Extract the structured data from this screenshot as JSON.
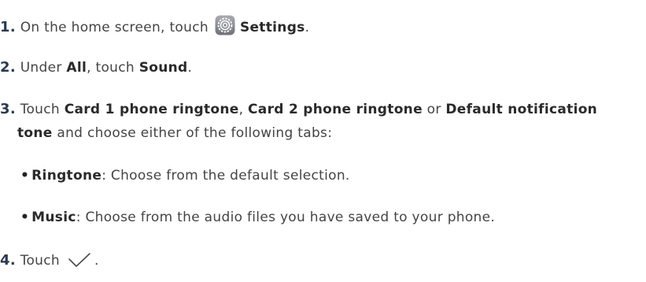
{
  "steps": [
    {
      "number": "1.",
      "pre": "On the home screen, touch",
      "icon": "settings-gear-icon",
      "bold": "Settings",
      "post": "."
    },
    {
      "number": "2.",
      "pre": "Under",
      "bold1": "All",
      "mid": ", touch",
      "bold2": "Sound",
      "post": "."
    },
    {
      "number": "3.",
      "pre": "Touch",
      "bold1": "Card 1 phone ringtone",
      "sep1": ",",
      "bold2": "Card 2 phone ringtone",
      "sep2": "or",
      "bold3": "Default notification",
      "cont_bold": "tone",
      "cont_text": "and choose either of the following tabs:",
      "sub_items": [
        {
          "bullet": "•",
          "label": "Ringtone",
          "text": ": Choose from the default selection."
        },
        {
          "bullet": "•",
          "label": "Music",
          "text": ": Choose from the audio files you have saved to your phone."
        }
      ]
    },
    {
      "number": "4.",
      "pre": "Touch",
      "icon": "checkmark-icon",
      "post": "."
    }
  ]
}
